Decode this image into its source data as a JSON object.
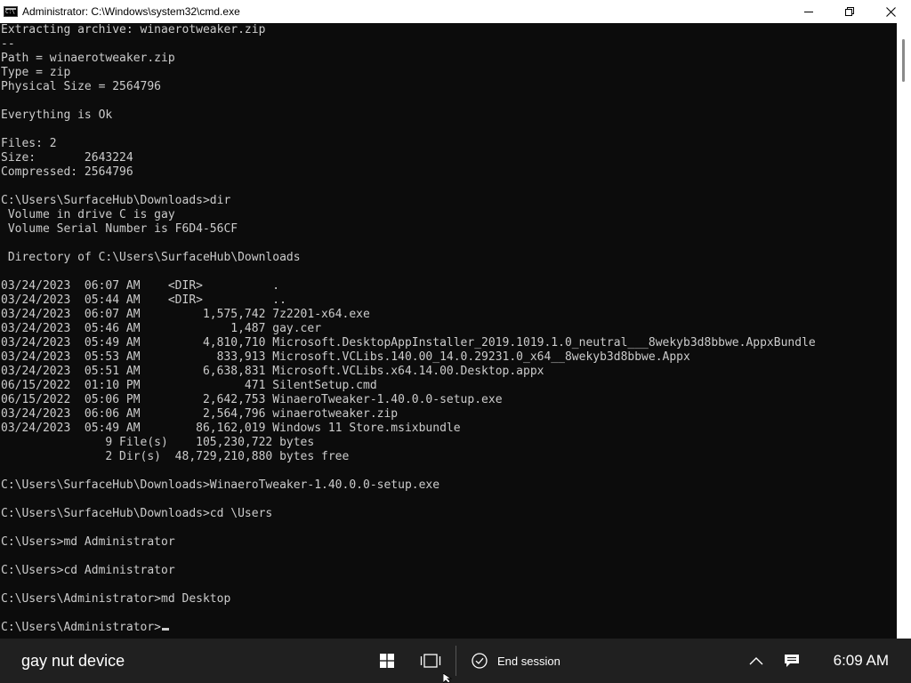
{
  "window": {
    "title": "Administrator: C:\\Windows\\system32\\cmd.exe"
  },
  "console": {
    "lines": [
      "Extracting archive: winaerotweaker.zip",
      "--",
      "Path = winaerotweaker.zip",
      "Type = zip",
      "Physical Size = 2564796",
      "",
      "Everything is Ok",
      "",
      "Files: 2",
      "Size:       2643224",
      "Compressed: 2564796",
      "",
      "C:\\Users\\SurfaceHub\\Downloads>dir",
      " Volume in drive C is gay",
      " Volume Serial Number is F6D4-56CF",
      "",
      " Directory of C:\\Users\\SurfaceHub\\Downloads",
      "",
      "03/24/2023  06:07 AM    <DIR>          .",
      "03/24/2023  05:44 AM    <DIR>          ..",
      "03/24/2023  06:07 AM         1,575,742 7z2201-x64.exe",
      "03/24/2023  05:46 AM             1,487 gay.cer",
      "03/24/2023  05:49 AM         4,810,710 Microsoft.DesktopAppInstaller_2019.1019.1.0_neutral___8wekyb3d8bbwe.AppxBundle",
      "03/24/2023  05:53 AM           833,913 Microsoft.VCLibs.140.00_14.0.29231.0_x64__8wekyb3d8bbwe.Appx",
      "03/24/2023  05:51 AM         6,638,831 Microsoft.VCLibs.x64.14.00.Desktop.appx",
      "06/15/2022  01:10 PM               471 SilentSetup.cmd",
      "06/15/2022  05:06 PM         2,642,753 WinaeroTweaker-1.40.0.0-setup.exe",
      "03/24/2023  06:06 AM         2,564,796 winaerotweaker.zip",
      "03/24/2023  05:49 AM        86,162,019 Windows 11 Store.msixbundle",
      "               9 File(s)    105,230,722 bytes",
      "               2 Dir(s)  48,729,210,880 bytes free",
      "",
      "C:\\Users\\SurfaceHub\\Downloads>WinaeroTweaker-1.40.0.0-setup.exe",
      "",
      "C:\\Users\\SurfaceHub\\Downloads>cd \\Users",
      "",
      "C:\\Users>md Administrator",
      "",
      "C:\\Users>cd Administrator",
      "",
      "C:\\Users\\Administrator>md Desktop",
      ""
    ],
    "prompt": "C:\\Users\\Administrator>"
  },
  "taskbar": {
    "device_name": "gay nut device",
    "end_session_label": "End session",
    "clock": "6:09 AM"
  },
  "icons": {
    "app": "cmd-icon",
    "minimize": "minimize-icon",
    "maximize": "restore-icon",
    "close": "close-icon",
    "start": "windows-start-icon",
    "task_view": "task-view-icon",
    "end_session": "check-circle-icon",
    "tray_expand": "chevron-up-icon",
    "notifications": "action-center-icon"
  },
  "colors": {
    "console_bg": "#0c0c0c",
    "console_fg": "#cccccc",
    "taskbar_bg": "#202020"
  }
}
